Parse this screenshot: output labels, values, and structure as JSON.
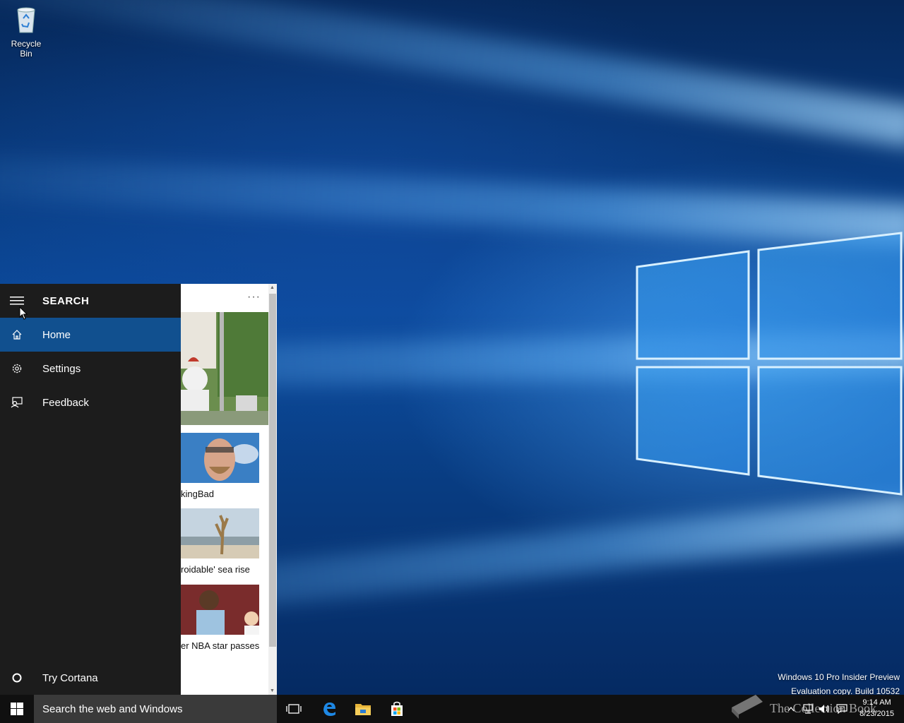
{
  "desktop": {
    "icons": [
      {
        "label": "Recycle Bin",
        "icon": "recycle-bin-icon"
      }
    ],
    "watermark": {
      "line1": "Windows 10 Pro Insider Preview",
      "line2": "Evaluation copy. Build 10532"
    }
  },
  "search_menu": {
    "title": "SEARCH",
    "items": [
      {
        "label": "Home",
        "icon": "home-icon",
        "active": true
      },
      {
        "label": "Settings",
        "icon": "gear-icon"
      },
      {
        "label": "Feedback",
        "icon": "feedback-icon"
      }
    ],
    "cortana": {
      "label": "Try Cortana",
      "icon": "circle-icon"
    }
  },
  "content": {
    "more_label": "···",
    "news": [
      {
        "caption": ""
      },
      {
        "caption": "kingBad"
      },
      {
        "caption": "roidable' sea rise"
      },
      {
        "caption": "er NBA star passes"
      }
    ]
  },
  "taskbar": {
    "search_placeholder": "Search the web and Windows",
    "pinned": [
      "task-view-icon",
      "edge-icon",
      "file-explorer-icon",
      "store-icon"
    ],
    "clock": {
      "time": "9:14 AM",
      "date": "8/23/2015"
    },
    "tray": [
      "chevron-up-icon",
      "network-icon",
      "volume-icon",
      "action-center-icon"
    ]
  },
  "overlay_watermark": "The Collection Book",
  "colors": {
    "accent": "#11508f",
    "menu_bg": "#1c1c1c",
    "taskbar_bg": "#101010"
  }
}
